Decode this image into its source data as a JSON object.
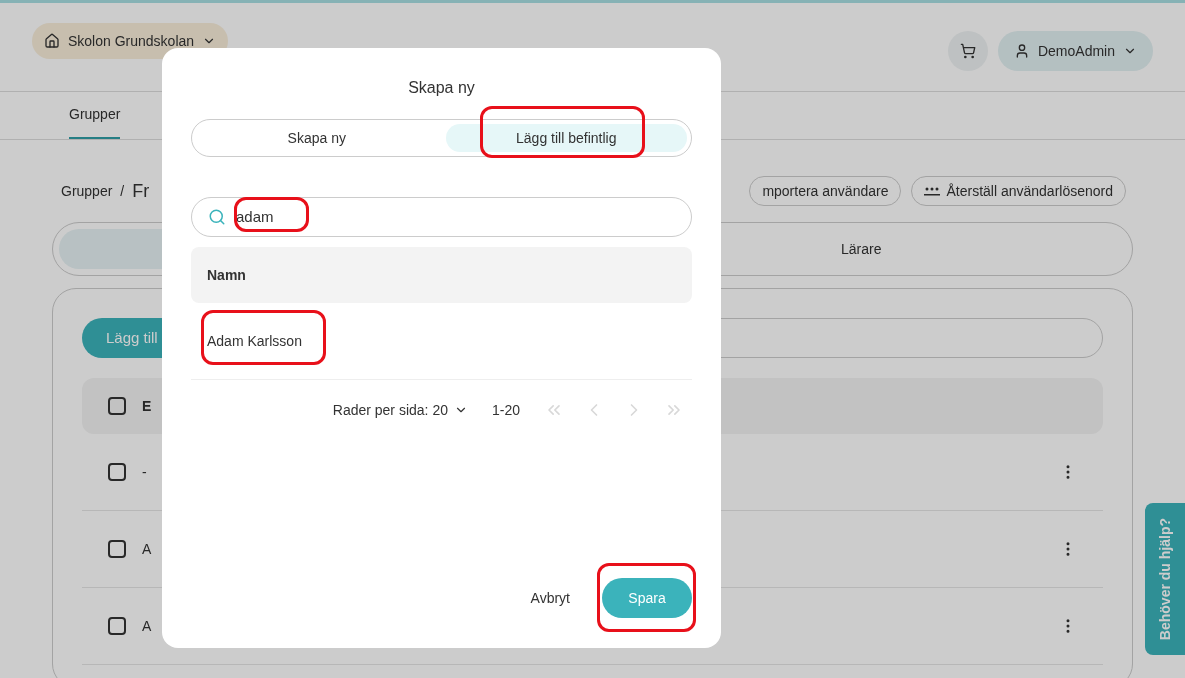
{
  "header": {
    "school": "Skolon Grundskolan",
    "user": "DemoAdmin"
  },
  "nav_tabs": [
    {
      "label": "Grupper",
      "selected": true
    }
  ],
  "breadcrumb": [
    "Grupper",
    "/",
    "Fr"
  ],
  "actions": [
    {
      "label": "mportera användare",
      "kind": "plain"
    },
    {
      "label": "Återställ användarlösenord",
      "kind": "password"
    }
  ],
  "segments": [
    {
      "selected": true
    },
    {
      "label": "Lärare",
      "selected": false
    }
  ],
  "card": {
    "add_button": "Lägg till",
    "table_header": "E",
    "select_all_checked": false,
    "rows": [
      {
        "text": "-",
        "checked": false
      },
      {
        "text": "A",
        "checked": false
      },
      {
        "text": "A",
        "checked": false
      }
    ]
  },
  "help_tab": "Behöver du hjälp?",
  "dialog": {
    "title": "Skapa ny",
    "tabs": [
      {
        "label": "Skapa ny",
        "selected": false
      },
      {
        "label": "Lägg till befintlig",
        "selected": true
      }
    ],
    "search": {
      "value": "adam"
    },
    "column": "Namn",
    "rows": [
      "Adam Karlsson"
    ],
    "pagination": {
      "rows_per_page": "Rader per sida: 20",
      "range": "1-20",
      "buttons": [
        {
          "kind": "first",
          "disabled": true
        },
        {
          "kind": "prev",
          "disabled": true
        },
        {
          "kind": "next",
          "disabled": true
        },
        {
          "kind": "last",
          "disabled": true
        }
      ]
    },
    "cancel": "Avbryt",
    "save": "Spara"
  }
}
